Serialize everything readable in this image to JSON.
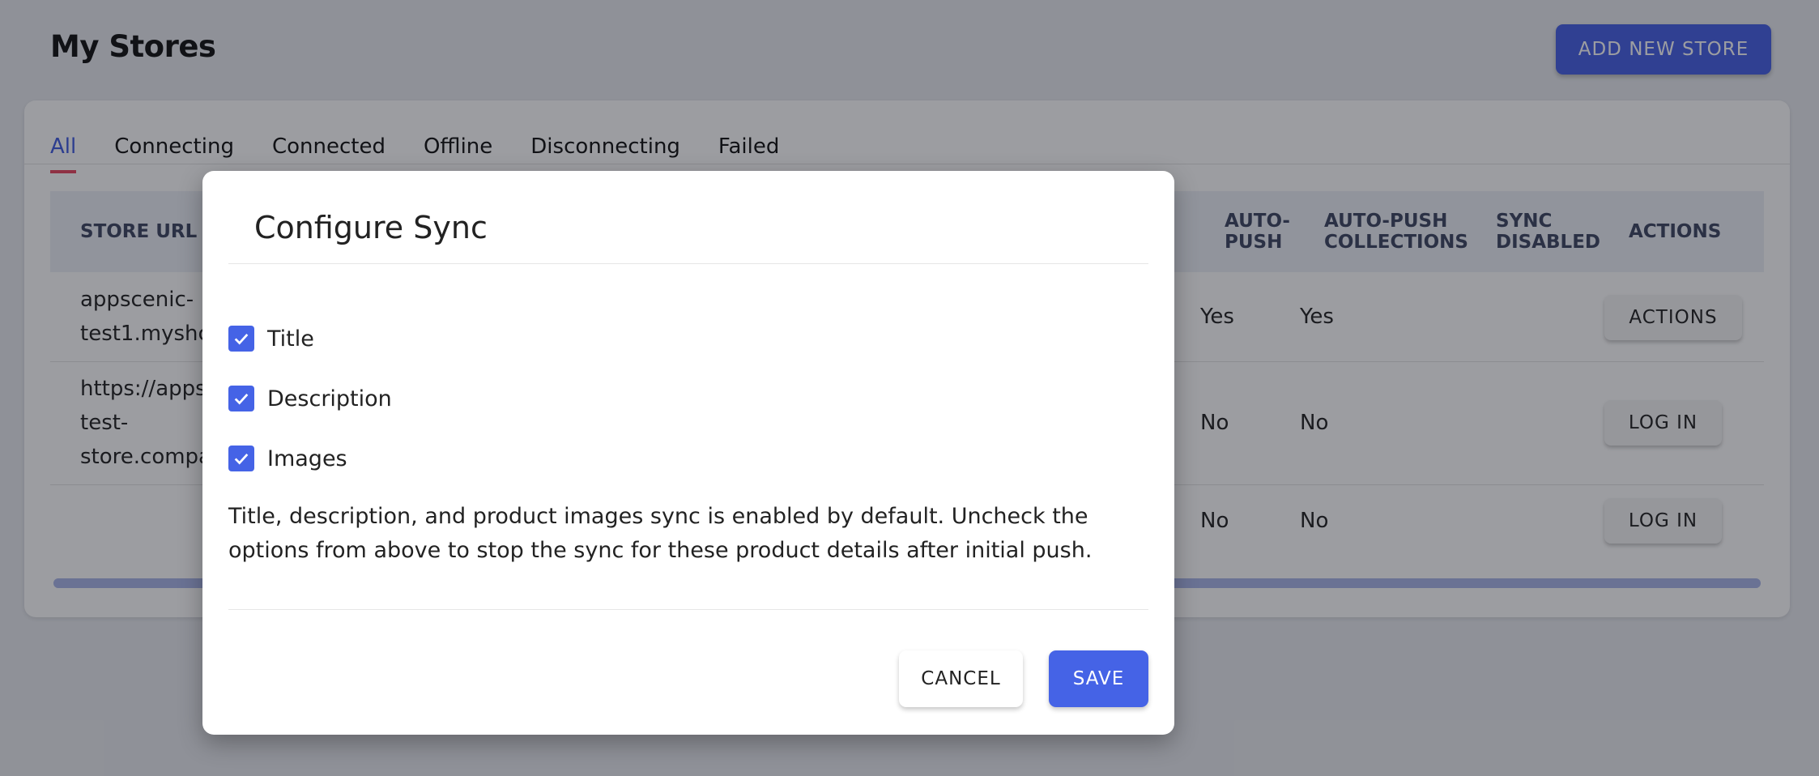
{
  "page": {
    "title": "My Stores",
    "add_button": "ADD NEW STORE"
  },
  "tabs": [
    {
      "label": "All",
      "active": true
    },
    {
      "label": "Connecting"
    },
    {
      "label": "Connected"
    },
    {
      "label": "Offline"
    },
    {
      "label": "Disconnecting"
    },
    {
      "label": "Failed"
    }
  ],
  "table": {
    "headers": {
      "store_url": "STORE URL /",
      "auto_push": [
        "AUTO-",
        "PUSH"
      ],
      "auto_push_collections": [
        "AUTO-PUSH",
        "COLLECTIONS"
      ],
      "sync_disabled": [
        "SYNC",
        "DISABLED"
      ],
      "actions": "ACTIONS"
    },
    "rows": [
      {
        "store": [
          "appscenic-",
          "test1.myshc"
        ],
        "auto_push": "Yes",
        "auto_push_collections": "Yes",
        "button": "ACTIONS"
      },
      {
        "store": [
          "https://apps",
          "test-",
          "store.compa"
        ],
        "auto_push": "No",
        "auto_push_collections": "No",
        "button": "LOG IN"
      },
      {
        "store": [],
        "auto_push": "No",
        "auto_push_collections": "No",
        "button": "LOG IN"
      }
    ]
  },
  "modal": {
    "title": "Configure Sync",
    "options": [
      {
        "label": "Title",
        "checked": true
      },
      {
        "label": "Description",
        "checked": true
      },
      {
        "label": "Images",
        "checked": true
      }
    ],
    "help_text": "Title, description, and product images sync is enabled by default. Uncheck the options from above to stop the sync for these product details after initial push.",
    "cancel_label": "CANCEL",
    "save_label": "SAVE"
  },
  "colors": {
    "accent": "#4563e6",
    "tab_indicator": "#e94560"
  }
}
